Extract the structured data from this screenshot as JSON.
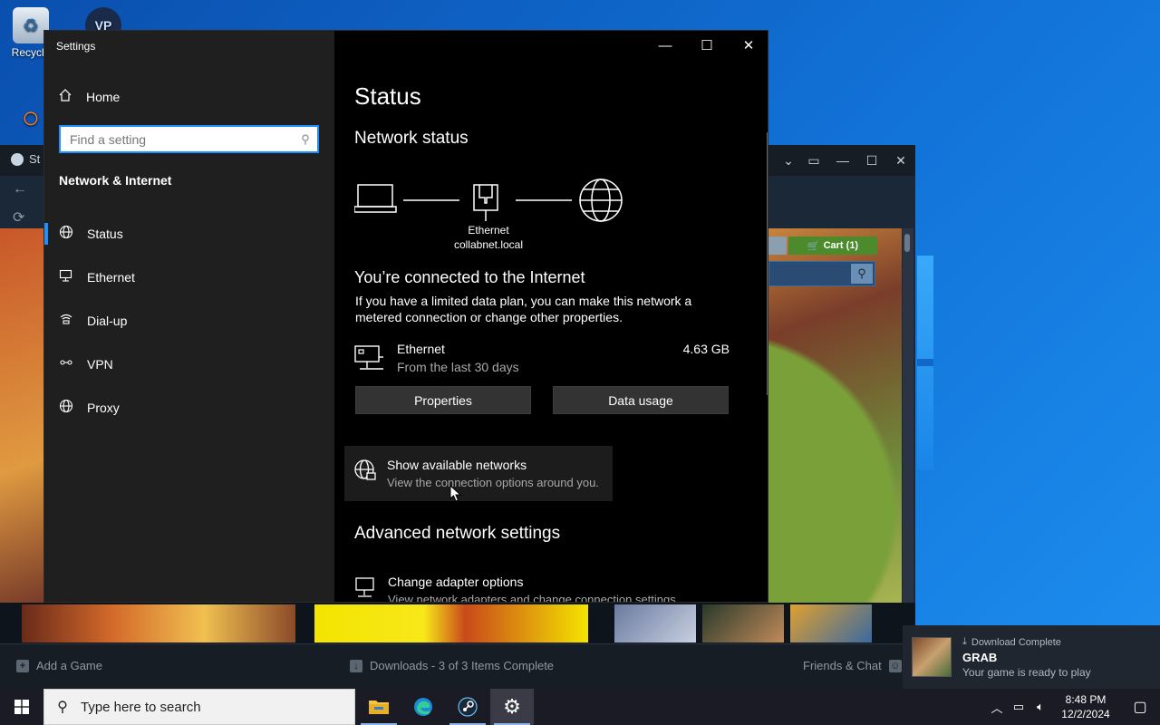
{
  "desktop": {
    "icons": [
      {
        "label": "Recycle",
        "name": "recycle-bin"
      },
      {
        "label": "VP",
        "name": "vp-app"
      }
    ]
  },
  "steam": {
    "title": "St",
    "cart_label": "Cart (1)",
    "add_game": "Add a Game",
    "downloads": "Downloads - 3 of 3 Items Complete",
    "friends": "Friends & Chat"
  },
  "settings": {
    "window_title": "Settings",
    "home_label": "Home",
    "search_placeholder": "Find a setting",
    "section_heading": "Network & Internet",
    "nav": [
      {
        "label": "Status",
        "icon": "globe-status-icon",
        "active": true
      },
      {
        "label": "Ethernet",
        "icon": "ethernet-icon",
        "active": false
      },
      {
        "label": "Dial-up",
        "icon": "dial-up-icon",
        "active": false
      },
      {
        "label": "VPN",
        "icon": "vpn-icon",
        "active": false
      },
      {
        "label": "Proxy",
        "icon": "globe-icon",
        "active": false
      }
    ],
    "page_title": "Status",
    "network_status_heading": "Network status",
    "diagram": {
      "adapter": "Ethernet",
      "domain": "collabnet.local"
    },
    "connected_text": "You’re connected to the Internet",
    "connected_desc": "If you have a limited data plan, you can make this network a metered connection or change other properties.",
    "ethernet": {
      "name": "Ethernet",
      "period": "From the last 30 days",
      "usage": "4.63 GB"
    },
    "buttons": {
      "properties": "Properties",
      "data_usage": "Data usage"
    },
    "available": {
      "title": "Show available networks",
      "subtitle": "View the connection options around you."
    },
    "advanced_heading": "Advanced network settings",
    "adapter_options": {
      "title": "Change adapter options",
      "subtitle": "View network adapters and change connection settings."
    }
  },
  "toast": {
    "header": "Download Complete",
    "game": "GRAB",
    "message": "Your game is ready to play"
  },
  "taskbar": {
    "search_text": "Type here to search",
    "time": "8:48 PM",
    "date": "12/2/2024"
  },
  "colors": {
    "accent": "#1e8fff",
    "settings_sidebar": "#1f1f1f",
    "steam_green": "#4c8b2b"
  }
}
